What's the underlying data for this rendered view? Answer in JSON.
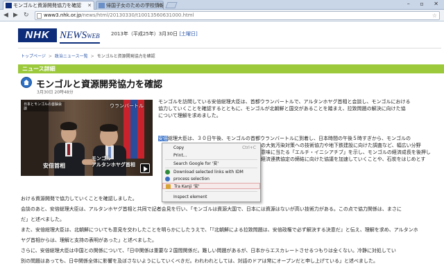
{
  "browser": {
    "tabs": [
      {
        "title": "モンゴルと資源開発協力を確認"
      },
      {
        "title": "帰国子女のための学校情報"
      }
    ],
    "url_host": "www3.nhk.or.jp",
    "url_path": "/news/html/20130330/t10013560631000.html"
  },
  "site": {
    "logo_nhk": "NHK",
    "logo_news": "NEWS",
    "logo_web": "WEB",
    "date_text": "2013年（平成25年）3月30日",
    "date_link": "[土曜日]"
  },
  "breadcrumb": [
    "トップページ",
    "政治ニュース一覧",
    "モンゴルと資源開発協力を確認"
  ],
  "section": {
    "title": "ニュース詳細"
  },
  "article": {
    "headline": "モンゴルと資源開発協力を確認",
    "time": "3月30日 20時48分",
    "photo": {
      "tag_top": "日本とモンゴルの首脳会談",
      "caption_right": "ウランバートル",
      "caption_left": "安倍首相",
      "caption_mid_1": "モンゴル",
      "caption_mid_2": "アルタンホヤグ首相"
    },
    "para1": [
      "モンゴルを訪問している安倍総理大臣は、首都ウランバートルで、アルタンホヤグ首相と会談し、モンゴルにおける",
      "協力していくことを確認するとともに、モンゴルが北朝鮮と国交があることを踏まえ、拉致問題の解決に向けた協",
      "について理解を求めました。"
    ],
    "para2_selected": "安倍",
    "para2_first_rest": "総理大臣は、３０日午後、モンゴルの首都ウランバートルに到着し、日本時間の午後５時すぎから、モンゴルの",
    "para2_right_lines": [
      "の大気汚染対策への技術協力や地下鉄建設に向けた調査など、幅広い分野",
      "意味に当たる「エルチ・イニシアチブ」を示し、モンゴルの経済成長を後押し",
      "",
      "経済連携協定の締結に向けた協議を加速していくことや、石炭をはじめとす"
    ],
    "lower_lines": [
      "おける資源開発で協力していくことを確認しました。",
      "会談のあと、安倍総理大臣は、アルタンホヤグ首相と共同で記者会見を行い、「モンゴルは資源大国で、日本には資源はないが高い技術力がある。この点で協力関係は、まさに",
      "だ」と述べました。",
      "また、安倍総理大臣は、北朝鮮についても意見を交わしたことを明らかにしたうえで、「『北朝鮮による拉致問題は、安倍政権で必ず解決する決意だ』と伝え、理解を求め、アルタンホ",
      "ヤグ首相からは、理解と支持の表明があった」と述べました。",
      "さらに、安倍総理大臣は中国との関係について、「日中関係は重要な２国間関係だ。難しい問題があるが、日本からエスカレートさせるつもりは全くない。冷静に対処してい",
      "別の問題はあっても、日中関係全体に影響を及ぼさないようにしていくべきだ。われわれとしては、対話のドアは常にオープンだと申し上げている」と述べました。"
    ]
  },
  "context_menu": {
    "copy": "Copy",
    "copy_shortcut": "Ctrl+C",
    "print": "Print...",
    "search_google": "Search Google for '安'",
    "download_idm": "Download selected links with IDM",
    "process_selection": "process selection",
    "tra_kanji": "Tra Kanji '安'",
    "inspect": "Inspect element"
  },
  "colors": {
    "nhk_blue": "#0d2d7a",
    "section_green": "#9cc93c",
    "selection_blue": "#3b74c9",
    "link_blue": "#2a55a8"
  }
}
